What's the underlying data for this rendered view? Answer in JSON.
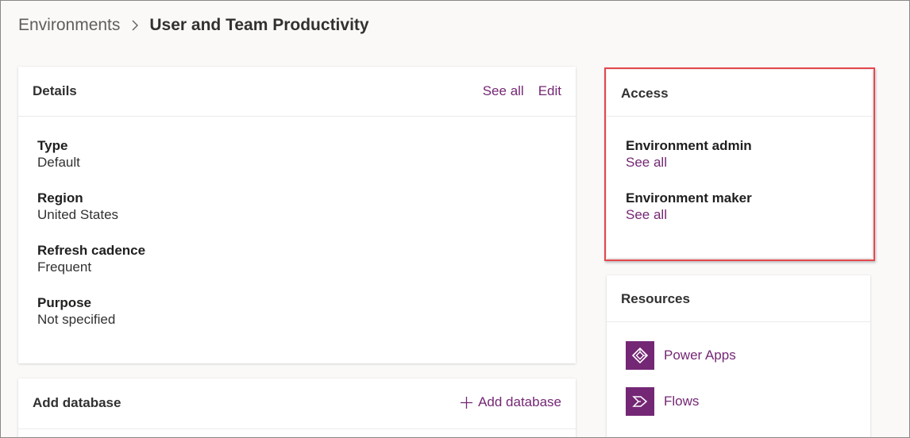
{
  "breadcrumb": {
    "parent": "Environments",
    "current": "User and Team Productivity"
  },
  "details": {
    "title": "Details",
    "see_all": "See all",
    "edit": "Edit",
    "fields": [
      {
        "label": "Type",
        "value": "Default"
      },
      {
        "label": "Region",
        "value": "United States"
      },
      {
        "label": "Refresh cadence",
        "value": "Frequent"
      },
      {
        "label": "Purpose",
        "value": "Not specified"
      }
    ]
  },
  "add_database": {
    "title": "Add database",
    "action": "Add database",
    "action_icon": "plus-icon"
  },
  "access": {
    "title": "Access",
    "items": [
      {
        "label": "Environment admin",
        "link": "See all"
      },
      {
        "label": "Environment maker",
        "link": "See all"
      }
    ],
    "highlight_color": "#e5474d"
  },
  "resources": {
    "title": "Resources",
    "items": [
      {
        "label": "Power Apps",
        "icon": "power-apps-icon"
      },
      {
        "label": "Flows",
        "icon": "flows-icon"
      }
    ]
  },
  "colors": {
    "accent": "#742774",
    "text": "#323130",
    "muted": "#605e5c",
    "background": "#faf9f8"
  }
}
